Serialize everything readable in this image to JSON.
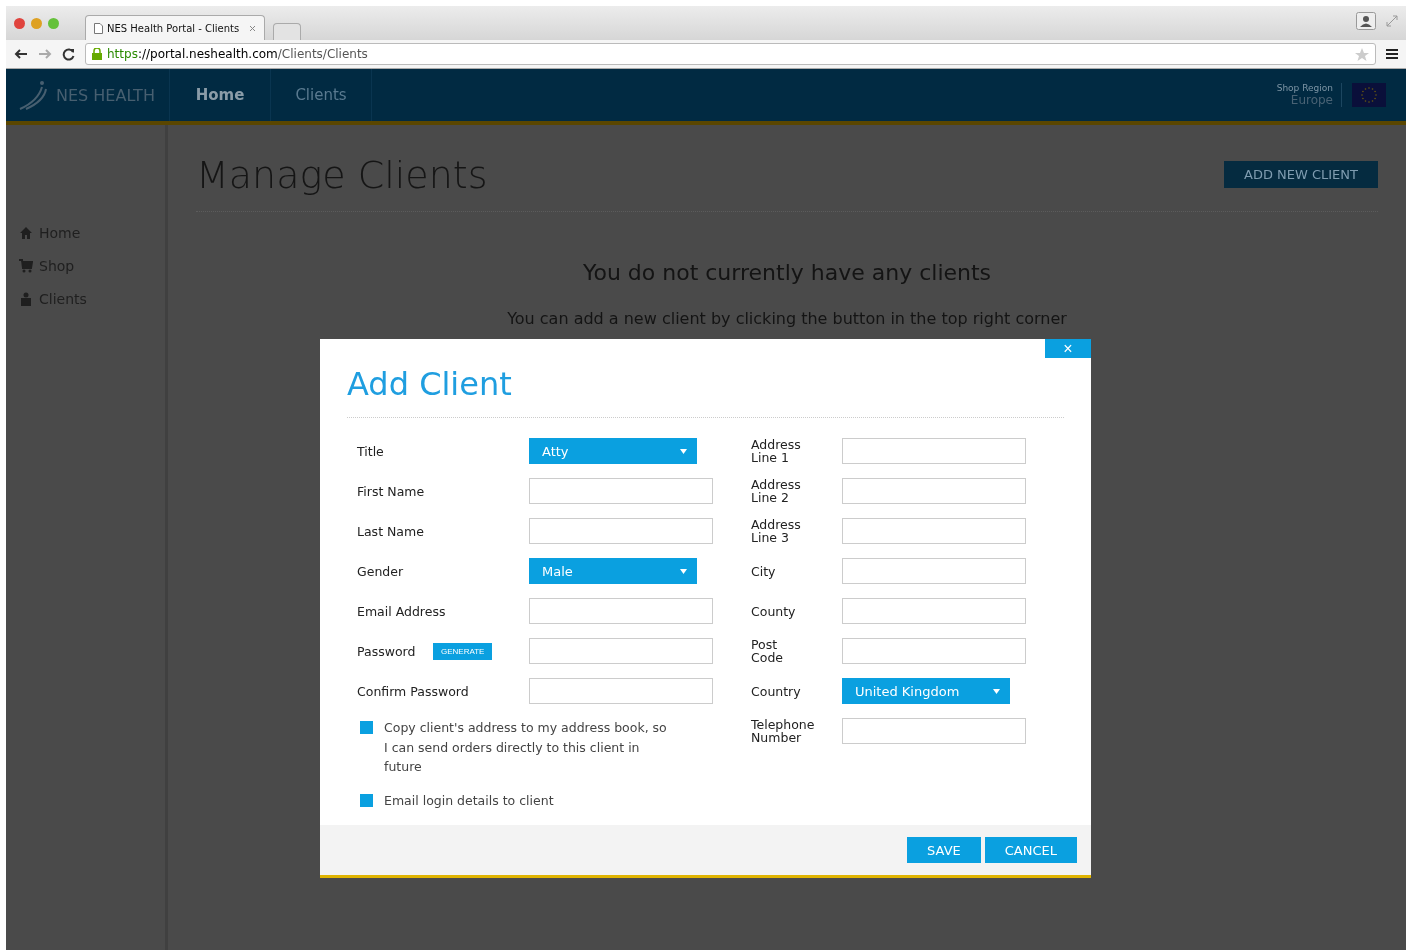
{
  "browser": {
    "tab_title": "NES Health Portal - Clients",
    "url_scheme": "https",
    "url_host": "://portal.neshealth.com",
    "url_path": "/Clients/Clients"
  },
  "navbar": {
    "brand": "NES HEALTH",
    "links": [
      {
        "label": "Home",
        "selected": true
      },
      {
        "label": "Clients",
        "selected": false
      }
    ],
    "region_label": "Shop Region",
    "region_value": "Europe"
  },
  "sidebar": {
    "items": [
      {
        "label": "Home",
        "kind": "home"
      },
      {
        "label": "Shop",
        "kind": "cart"
      },
      {
        "label": "Clients",
        "kind": "person"
      }
    ]
  },
  "main": {
    "title": "Manage Clients",
    "add_button": "ADD NEW CLIENT",
    "empty_title": "You do not currently have any clients",
    "empty_hint": "You can add a new client by clicking the button in the top right corner"
  },
  "dialog": {
    "close": "×",
    "title": "Add Client",
    "left_fields": [
      {
        "label": "Title",
        "kind": "select",
        "value": "Atty"
      },
      {
        "label": "First Name",
        "kind": "text"
      },
      {
        "label": "Last Name",
        "kind": "text"
      },
      {
        "label": "Gender",
        "kind": "select",
        "value": "Male"
      },
      {
        "label": "Email Address",
        "kind": "text"
      },
      {
        "label": "Password",
        "kind": "text",
        "button": "GENERATE"
      },
      {
        "label": "Confirm Password",
        "kind": "text"
      }
    ],
    "checkboxes": [
      {
        "label": "Copy client's address to my address book, so I can send orders directly to this client in future",
        "checked": true
      },
      {
        "label": "Email login details to client",
        "checked": true
      }
    ],
    "right_fields": [
      {
        "label": "Address Line 1",
        "kind": "text"
      },
      {
        "label": "Address Line 2",
        "kind": "text"
      },
      {
        "label": "Address Line 3",
        "kind": "text"
      },
      {
        "label": "City",
        "kind": "text"
      },
      {
        "label": "County",
        "kind": "text"
      },
      {
        "label": "Post Code",
        "kind": "text"
      },
      {
        "label": "Country",
        "kind": "select",
        "value": "United Kingdom"
      },
      {
        "label": "Telephone Number",
        "kind": "text"
      }
    ],
    "buttons": [
      "SAVE",
      "CANCEL"
    ]
  }
}
